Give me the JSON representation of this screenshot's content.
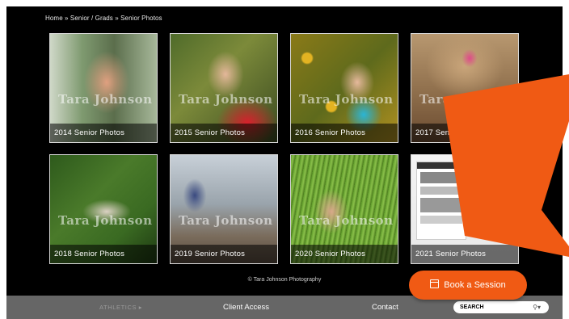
{
  "breadcrumb": "Home » Senior / Grads » Senior Photos",
  "gallery": [
    {
      "caption": "2014 Senior Photos",
      "watermark": "Tara Johnson"
    },
    {
      "caption": "2015 Senior Photos",
      "watermark": "Tara Johnson"
    },
    {
      "caption": "2016 Senior Photos",
      "watermark": "Tara Johnson"
    },
    {
      "caption": "2017 Senior Photos",
      "watermark": "Tara Johnson"
    },
    {
      "caption": "2018 Senior Photos",
      "watermark": "Tara Johnson"
    },
    {
      "caption": "2019 Senior Photos",
      "watermark": "Tara Johnson"
    },
    {
      "caption": "2020 Senior Photos",
      "watermark": "Tara Johnson"
    },
    {
      "caption": "2021 Senior Photos",
      "watermark": ""
    }
  ],
  "copyright": "© Tara Johnson Photography",
  "book_button": {
    "label": "Book a Session",
    "icon": "calendar-icon",
    "color": "#f05a14"
  },
  "nav": {
    "athletics": "ATHLETICS ▸",
    "client_access": "Client Access",
    "contact": "Contact",
    "search_placeholder": "SEARCH",
    "search_icon": "search-icon"
  },
  "colors": {
    "background": "#000000",
    "navbar": "#666666",
    "accent": "#f05a14"
  }
}
